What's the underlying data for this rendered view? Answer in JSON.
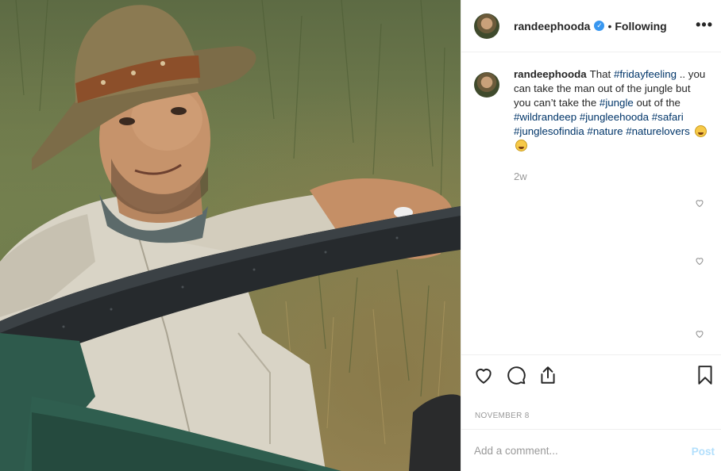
{
  "post": {
    "username": "randeephooda",
    "verified_badge": "verified-icon",
    "separator": "•",
    "follow_status": "Following",
    "more_label": "•••",
    "caption": {
      "username": "randeephooda",
      "segments": [
        {
          "t": "text",
          "v": "That "
        },
        {
          "t": "tag",
          "v": "#fridayfeeling"
        },
        {
          "t": "text",
          "v": " .. you can take the man out of the jungle but you can’t take the "
        },
        {
          "t": "tag",
          "v": "#jungle"
        },
        {
          "t": "text",
          "v": " out of the "
        },
        {
          "t": "tag",
          "v": "#wildrandeep"
        },
        {
          "t": "text",
          "v": " "
        },
        {
          "t": "tag",
          "v": "#jungleehooda"
        },
        {
          "t": "text",
          "v": " "
        },
        {
          "t": "tag",
          "v": "#safari"
        },
        {
          "t": "text",
          "v": " "
        },
        {
          "t": "tag",
          "v": "#junglesofindia"
        },
        {
          "t": "text",
          "v": " "
        },
        {
          "t": "tag",
          "v": "#nature"
        },
        {
          "t": "text",
          "v": " "
        },
        {
          "t": "tag",
          "v": "#naturelovers"
        },
        {
          "t": "text",
          "v": " "
        }
      ],
      "emojis": [
        "grinning-squinting-face",
        "grinning-squinting-face"
      ],
      "age": "2w"
    },
    "date": "NOVEMBER 8",
    "comment_input": {
      "placeholder": "Add a comment...",
      "value": ""
    },
    "post_button": "Post"
  },
  "colors": {
    "hashtag": "#003569",
    "verified": "#3897f0",
    "post_disabled": "#b2dffc",
    "muted": "#999999"
  },
  "icons": {
    "like": "heart-icon",
    "comment": "comment-icon",
    "share": "share-icon",
    "save": "bookmark-icon",
    "comment_like": "small-heart-icon"
  }
}
